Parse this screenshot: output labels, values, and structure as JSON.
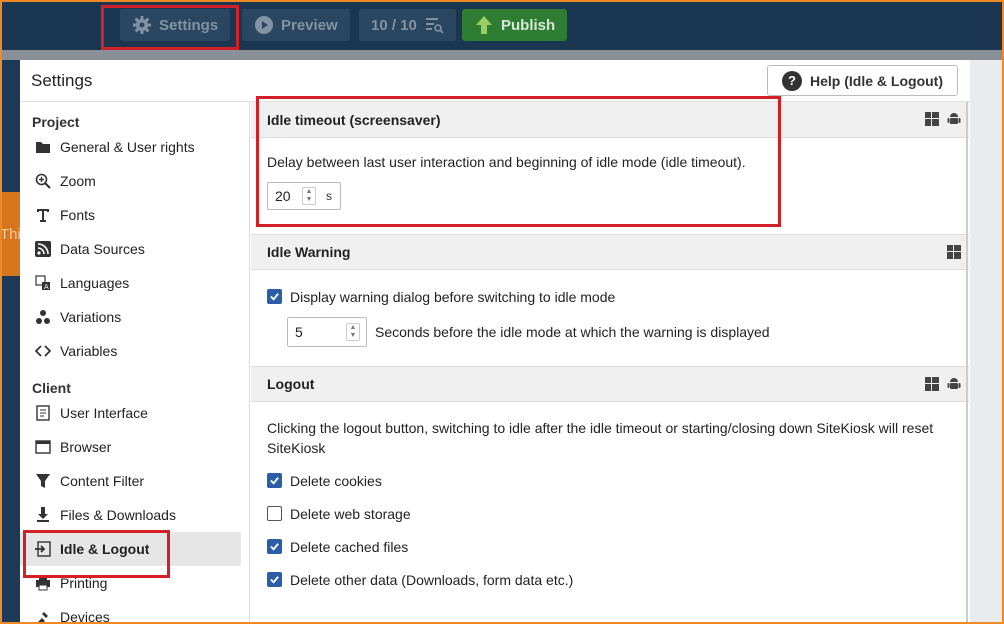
{
  "toolbar": {
    "settings": "Settings",
    "preview": "Preview",
    "counter": "10 / 10",
    "publish": "Publish"
  },
  "background": {
    "orange_text": "Thi"
  },
  "dialog": {
    "title": "Settings",
    "help": "Help (Idle & Logout)"
  },
  "sidebar": {
    "groups": [
      "Project",
      "Client"
    ],
    "project_items": [
      {
        "label": "General & User rights",
        "icon": "folder-icon"
      },
      {
        "label": "Zoom",
        "icon": "zoom-icon"
      },
      {
        "label": "Fonts",
        "icon": "font-icon"
      },
      {
        "label": "Data Sources",
        "icon": "rss-icon"
      },
      {
        "label": "Languages",
        "icon": "language-icon"
      },
      {
        "label": "Variations",
        "icon": "variations-icon"
      },
      {
        "label": "Variables",
        "icon": "code-icon"
      }
    ],
    "client_items": [
      {
        "label": "User Interface",
        "icon": "user-interface-icon"
      },
      {
        "label": "Browser",
        "icon": "browser-icon"
      },
      {
        "label": "Content Filter",
        "icon": "filter-icon"
      },
      {
        "label": "Files & Downloads",
        "icon": "download-icon"
      },
      {
        "label": "Idle & Logout",
        "icon": "logout-icon"
      },
      {
        "label": "Printing",
        "icon": "printer-icon"
      },
      {
        "label": "Devices",
        "icon": "devices-icon"
      }
    ],
    "active": "Idle & Logout"
  },
  "sections": {
    "idle_timeout": {
      "title": "Idle timeout (screensaver)",
      "description": "Delay between last user interaction and beginning of idle mode (idle timeout).",
      "value": "20",
      "unit": "s"
    },
    "idle_warning": {
      "title": "Idle Warning",
      "checkbox_label": "Display warning dialog before switching to idle mode",
      "checked": true,
      "seconds_value": "5",
      "seconds_label": "Seconds before the idle mode at which the warning is displayed"
    },
    "logout": {
      "title": "Logout",
      "description": "Clicking the logout button, switching to idle after the idle timeout or starting/closing down SiteKiosk will reset SiteKiosk",
      "options": [
        {
          "label": "Delete cookies",
          "checked": true
        },
        {
          "label": "Delete web storage",
          "checked": false
        },
        {
          "label": "Delete cached files",
          "checked": true
        },
        {
          "label": "Delete other data (Downloads, form data etc.)",
          "checked": true
        }
      ]
    }
  },
  "colors": {
    "highlight": "#d32027",
    "checkbox": "#2a5fa8",
    "publish": "#2e7d32",
    "topbar": "#1a3650"
  }
}
